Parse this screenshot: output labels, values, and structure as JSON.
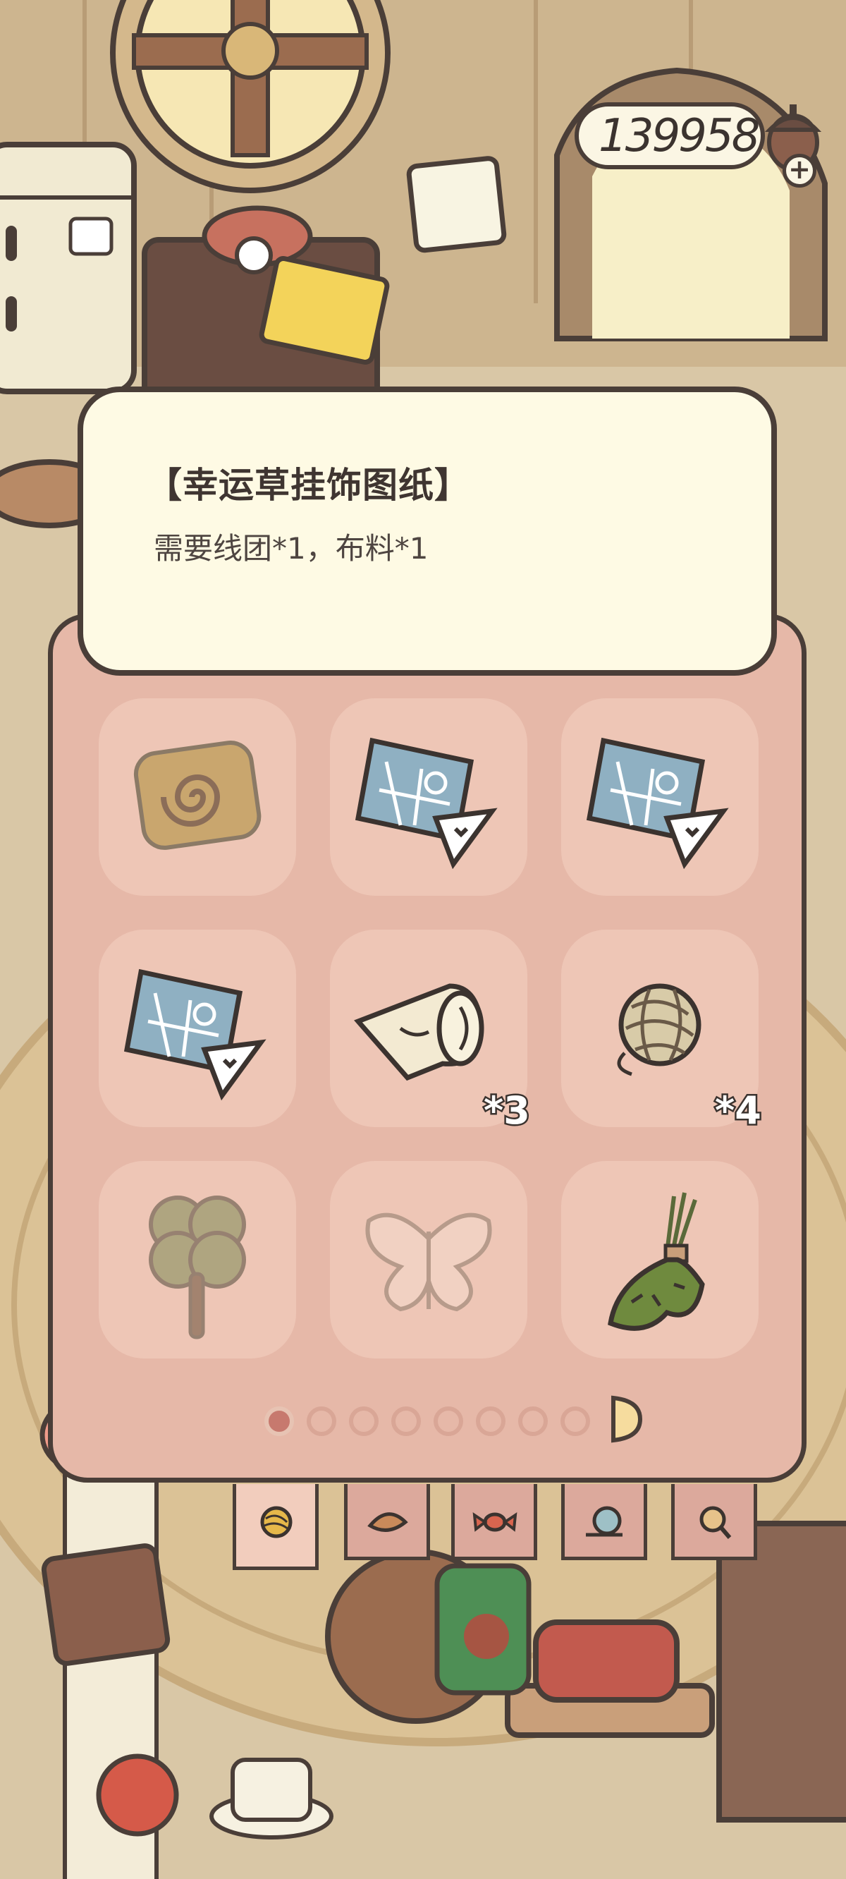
{
  "currency": {
    "amount": "139958",
    "add_label": "+"
  },
  "tooltip": {
    "title": "【幸运草挂饰图纸】",
    "description": "需要线团*1，布料*1"
  },
  "inventory": {
    "slots": [
      {
        "item": "swirl-cookie-icon",
        "quantity": ""
      },
      {
        "item": "blueprint-icon",
        "quantity": ""
      },
      {
        "item": "blueprint-icon",
        "quantity": ""
      },
      {
        "item": "blueprint-icon",
        "quantity": ""
      },
      {
        "item": "fabric-roll-icon",
        "quantity": "*3"
      },
      {
        "item": "yarn-ball-icon",
        "quantity": "*4"
      },
      {
        "item": "clover-charm-icon",
        "quantity": ""
      },
      {
        "item": "butterfly-outline-icon",
        "quantity": ""
      },
      {
        "item": "herb-bundle-icon",
        "quantity": ""
      }
    ],
    "page_current": 1,
    "page_total": 8
  },
  "tabs": [
    "yarn-tab-icon",
    "leaf-tab-icon",
    "candy-tab-icon",
    "snail-tab-icon",
    "search-tab-icon"
  ],
  "colors": {
    "panel": "#e6b8a8",
    "slot": "#eec6b6",
    "tooltip": "#fefae4",
    "outline": "#4a3e38"
  }
}
